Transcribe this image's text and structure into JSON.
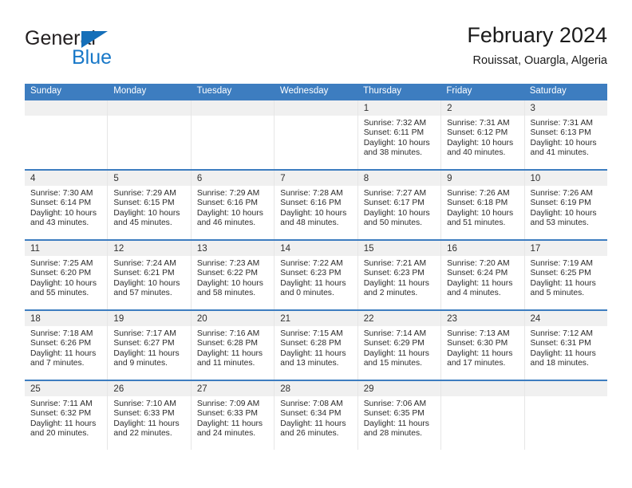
{
  "brand": {
    "name_part1": "General",
    "name_part2": "Blue",
    "triangle_color": "#156fb9",
    "blue_color": "#1878c8"
  },
  "header": {
    "title": "February 2024",
    "subtitle": "Rouissat, Ouargla, Algeria"
  },
  "theme": {
    "header_row_bg": "#3d7dc0",
    "header_row_text": "#ffffff",
    "day_band_bg": "#f0f0f0",
    "week_separator": "#3d7dc0"
  },
  "weekdays": [
    "Sunday",
    "Monday",
    "Tuesday",
    "Wednesday",
    "Thursday",
    "Friday",
    "Saturday"
  ],
  "weeks": [
    [
      {
        "day": "",
        "sunrise": "",
        "sunset": "",
        "daylight1": "",
        "daylight2": ""
      },
      {
        "day": "",
        "sunrise": "",
        "sunset": "",
        "daylight1": "",
        "daylight2": ""
      },
      {
        "day": "",
        "sunrise": "",
        "sunset": "",
        "daylight1": "",
        "daylight2": ""
      },
      {
        "day": "",
        "sunrise": "",
        "sunset": "",
        "daylight1": "",
        "daylight2": ""
      },
      {
        "day": "1",
        "sunrise": "Sunrise: 7:32 AM",
        "sunset": "Sunset: 6:11 PM",
        "daylight1": "Daylight: 10 hours",
        "daylight2": "and 38 minutes."
      },
      {
        "day": "2",
        "sunrise": "Sunrise: 7:31 AM",
        "sunset": "Sunset: 6:12 PM",
        "daylight1": "Daylight: 10 hours",
        "daylight2": "and 40 minutes."
      },
      {
        "day": "3",
        "sunrise": "Sunrise: 7:31 AM",
        "sunset": "Sunset: 6:13 PM",
        "daylight1": "Daylight: 10 hours",
        "daylight2": "and 41 minutes."
      }
    ],
    [
      {
        "day": "4",
        "sunrise": "Sunrise: 7:30 AM",
        "sunset": "Sunset: 6:14 PM",
        "daylight1": "Daylight: 10 hours",
        "daylight2": "and 43 minutes."
      },
      {
        "day": "5",
        "sunrise": "Sunrise: 7:29 AM",
        "sunset": "Sunset: 6:15 PM",
        "daylight1": "Daylight: 10 hours",
        "daylight2": "and 45 minutes."
      },
      {
        "day": "6",
        "sunrise": "Sunrise: 7:29 AM",
        "sunset": "Sunset: 6:16 PM",
        "daylight1": "Daylight: 10 hours",
        "daylight2": "and 46 minutes."
      },
      {
        "day": "7",
        "sunrise": "Sunrise: 7:28 AM",
        "sunset": "Sunset: 6:16 PM",
        "daylight1": "Daylight: 10 hours",
        "daylight2": "and 48 minutes."
      },
      {
        "day": "8",
        "sunrise": "Sunrise: 7:27 AM",
        "sunset": "Sunset: 6:17 PM",
        "daylight1": "Daylight: 10 hours",
        "daylight2": "and 50 minutes."
      },
      {
        "day": "9",
        "sunrise": "Sunrise: 7:26 AM",
        "sunset": "Sunset: 6:18 PM",
        "daylight1": "Daylight: 10 hours",
        "daylight2": "and 51 minutes."
      },
      {
        "day": "10",
        "sunrise": "Sunrise: 7:26 AM",
        "sunset": "Sunset: 6:19 PM",
        "daylight1": "Daylight: 10 hours",
        "daylight2": "and 53 minutes."
      }
    ],
    [
      {
        "day": "11",
        "sunrise": "Sunrise: 7:25 AM",
        "sunset": "Sunset: 6:20 PM",
        "daylight1": "Daylight: 10 hours",
        "daylight2": "and 55 minutes."
      },
      {
        "day": "12",
        "sunrise": "Sunrise: 7:24 AM",
        "sunset": "Sunset: 6:21 PM",
        "daylight1": "Daylight: 10 hours",
        "daylight2": "and 57 minutes."
      },
      {
        "day": "13",
        "sunrise": "Sunrise: 7:23 AM",
        "sunset": "Sunset: 6:22 PM",
        "daylight1": "Daylight: 10 hours",
        "daylight2": "and 58 minutes."
      },
      {
        "day": "14",
        "sunrise": "Sunrise: 7:22 AM",
        "sunset": "Sunset: 6:23 PM",
        "daylight1": "Daylight: 11 hours",
        "daylight2": "and 0 minutes."
      },
      {
        "day": "15",
        "sunrise": "Sunrise: 7:21 AM",
        "sunset": "Sunset: 6:23 PM",
        "daylight1": "Daylight: 11 hours",
        "daylight2": "and 2 minutes."
      },
      {
        "day": "16",
        "sunrise": "Sunrise: 7:20 AM",
        "sunset": "Sunset: 6:24 PM",
        "daylight1": "Daylight: 11 hours",
        "daylight2": "and 4 minutes."
      },
      {
        "day": "17",
        "sunrise": "Sunrise: 7:19 AM",
        "sunset": "Sunset: 6:25 PM",
        "daylight1": "Daylight: 11 hours",
        "daylight2": "and 5 minutes."
      }
    ],
    [
      {
        "day": "18",
        "sunrise": "Sunrise: 7:18 AM",
        "sunset": "Sunset: 6:26 PM",
        "daylight1": "Daylight: 11 hours",
        "daylight2": "and 7 minutes."
      },
      {
        "day": "19",
        "sunrise": "Sunrise: 7:17 AM",
        "sunset": "Sunset: 6:27 PM",
        "daylight1": "Daylight: 11 hours",
        "daylight2": "and 9 minutes."
      },
      {
        "day": "20",
        "sunrise": "Sunrise: 7:16 AM",
        "sunset": "Sunset: 6:28 PM",
        "daylight1": "Daylight: 11 hours",
        "daylight2": "and 11 minutes."
      },
      {
        "day": "21",
        "sunrise": "Sunrise: 7:15 AM",
        "sunset": "Sunset: 6:28 PM",
        "daylight1": "Daylight: 11 hours",
        "daylight2": "and 13 minutes."
      },
      {
        "day": "22",
        "sunrise": "Sunrise: 7:14 AM",
        "sunset": "Sunset: 6:29 PM",
        "daylight1": "Daylight: 11 hours",
        "daylight2": "and 15 minutes."
      },
      {
        "day": "23",
        "sunrise": "Sunrise: 7:13 AM",
        "sunset": "Sunset: 6:30 PM",
        "daylight1": "Daylight: 11 hours",
        "daylight2": "and 17 minutes."
      },
      {
        "day": "24",
        "sunrise": "Sunrise: 7:12 AM",
        "sunset": "Sunset: 6:31 PM",
        "daylight1": "Daylight: 11 hours",
        "daylight2": "and 18 minutes."
      }
    ],
    [
      {
        "day": "25",
        "sunrise": "Sunrise: 7:11 AM",
        "sunset": "Sunset: 6:32 PM",
        "daylight1": "Daylight: 11 hours",
        "daylight2": "and 20 minutes."
      },
      {
        "day": "26",
        "sunrise": "Sunrise: 7:10 AM",
        "sunset": "Sunset: 6:33 PM",
        "daylight1": "Daylight: 11 hours",
        "daylight2": "and 22 minutes."
      },
      {
        "day": "27",
        "sunrise": "Sunrise: 7:09 AM",
        "sunset": "Sunset: 6:33 PM",
        "daylight1": "Daylight: 11 hours",
        "daylight2": "and 24 minutes."
      },
      {
        "day": "28",
        "sunrise": "Sunrise: 7:08 AM",
        "sunset": "Sunset: 6:34 PM",
        "daylight1": "Daylight: 11 hours",
        "daylight2": "and 26 minutes."
      },
      {
        "day": "29",
        "sunrise": "Sunrise: 7:06 AM",
        "sunset": "Sunset: 6:35 PM",
        "daylight1": "Daylight: 11 hours",
        "daylight2": "and 28 minutes."
      },
      {
        "day": "",
        "sunrise": "",
        "sunset": "",
        "daylight1": "",
        "daylight2": ""
      },
      {
        "day": "",
        "sunrise": "",
        "sunset": "",
        "daylight1": "",
        "daylight2": ""
      }
    ]
  ]
}
